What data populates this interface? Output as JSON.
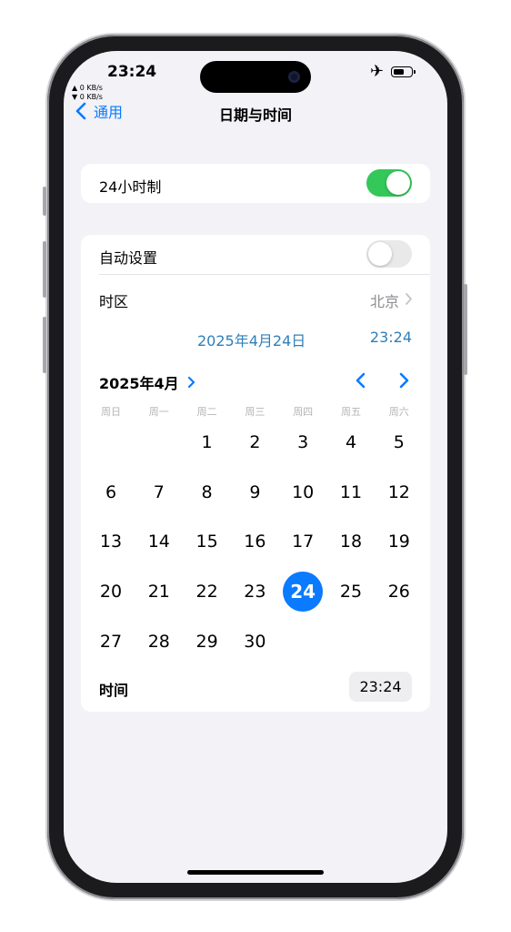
{
  "status_bar": {
    "time": "23:24",
    "net_up": "▲ 0 KB/s",
    "net_down": "▼ 0 KB/s",
    "battery_level": 0.65
  },
  "nav": {
    "back_label": "通用",
    "title": "日期与时间"
  },
  "settings": {
    "hour24_label": "24小时制",
    "hour24_on": true,
    "auto_label": "自动设置",
    "auto_on": false,
    "timezone_label": "时区",
    "timezone_value": "北京"
  },
  "selection": {
    "date": "2025年4月24日",
    "time": "23:24"
  },
  "calendar": {
    "month_label": "2025年4月",
    "weekdays": [
      "周日",
      "周一",
      "周二",
      "周三",
      "周四",
      "周五",
      "周六"
    ],
    "first_weekday_index": 2,
    "days_in_month": 30,
    "selected_day": 24
  },
  "time_row": {
    "label": "时间",
    "value": "23:24"
  },
  "colors": {
    "accent": "#0a7aff",
    "toggle_on": "#34c759",
    "toggle_off": "#e9e9ea",
    "secondary_text": "#8e8e93",
    "background": "#f2f2f7"
  }
}
